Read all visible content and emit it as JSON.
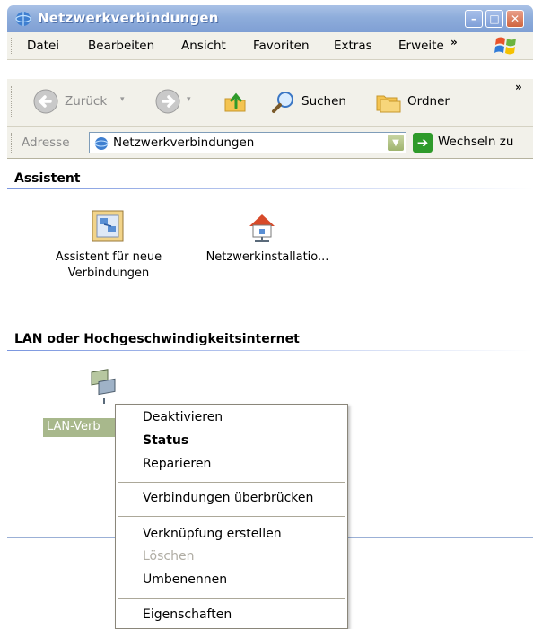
{
  "window": {
    "title": "Netzwerkverbindungen",
    "buttons": {
      "minimize": "–",
      "maximize": "□",
      "close": "✕"
    }
  },
  "menu": {
    "items": [
      "Datei",
      "Bearbeiten",
      "Ansicht",
      "Favoriten",
      "Extras",
      "Erweite"
    ],
    "overflow": "»"
  },
  "toolbar": {
    "back_label": "Zurück",
    "search_label": "Suchen",
    "folders_label": "Ordner",
    "overflow": "»"
  },
  "address": {
    "label": "Adresse",
    "value": "Netzwerkverbindungen",
    "go_label": "Wechseln zu"
  },
  "groups": [
    {
      "heading": "Assistent",
      "items": [
        {
          "label_line1": "Assistent für neue",
          "label_line2": "Verbindungen"
        },
        {
          "label_line1": "Netzwerkinstallatio...",
          "label_line2": ""
        }
      ]
    },
    {
      "heading": "LAN oder Hochgeschwindigkeitsinternet",
      "items": [
        {
          "label_line1": "LAN-Verb",
          "label_line2": ""
        }
      ]
    }
  ],
  "context_menu": {
    "items": [
      {
        "label": "Deaktivieren",
        "style": "normal"
      },
      {
        "label": "Status",
        "style": "bold"
      },
      {
        "label": "Reparieren",
        "style": "normal"
      },
      {
        "label": "Verbindungen überbrücken",
        "style": "normal"
      },
      {
        "label": "Verknüpfung erstellen",
        "style": "normal"
      },
      {
        "label": "Löschen",
        "style": "disabled"
      },
      {
        "label": "Umbenennen",
        "style": "normal"
      },
      {
        "label": "Eigenschaften",
        "style": "normal"
      }
    ]
  },
  "colors": {
    "title_bar": "#8eaddb",
    "selection": "#a8b88c",
    "go_arrow": "#2e9a2a"
  }
}
